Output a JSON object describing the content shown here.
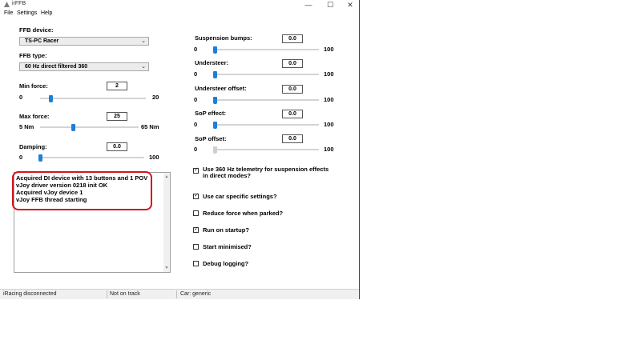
{
  "window": {
    "title": "irFFB",
    "minimize": "—",
    "maximize": "☐",
    "close": "✕"
  },
  "menu": [
    "File",
    "Settings",
    "Help"
  ],
  "left": {
    "ffb_device_label": "FFB device:",
    "ffb_device_value": "TS-PC Racer",
    "ffb_type_label": "FFB type:",
    "ffb_type_value": "60 Hz direct filtered 360",
    "min_force": {
      "label": "Min force:",
      "value": "2",
      "min": "0",
      "max": "20",
      "level": 0.1
    },
    "max_force": {
      "label": "Max force:",
      "value": "25",
      "min": "5 Nm",
      "max": "65 Nm",
      "level": 0.33
    },
    "damping": {
      "label": "Damping:",
      "value": "0.0",
      "min": "0",
      "max": "100",
      "level": 0.0
    }
  },
  "log": [
    "Acquired DI device with 13 buttons and 1 POV",
    "vJoy driver version 0218 init OK",
    "Acquired vJoy device 1",
    "vJoy FFB thread starting"
  ],
  "right": {
    "suspension_bumps": {
      "label": "Suspension bumps:",
      "value": "0.0",
      "min": "0",
      "max": "100",
      "level": 0.0
    },
    "understeer": {
      "label": "Understeer:",
      "value": "0.0",
      "min": "0",
      "max": "100",
      "level": 0.0
    },
    "understeer_offset": {
      "label": "Understeer offset:",
      "value": "0.0",
      "min": "0",
      "max": "100",
      "level": 0.0
    },
    "sop_effect": {
      "label": "SoP effect:",
      "value": "0.0",
      "min": "0",
      "max": "100",
      "level": 0.0
    },
    "sop_offset": {
      "label": "SoP offset:",
      "value": "0.0",
      "min": "0",
      "max": "100",
      "level": 0.0
    }
  },
  "checkboxes": {
    "use360": {
      "label_line1": "Use 360 Hz telemetry for suspension effects",
      "label_line2": "in direct modes?",
      "checked": true
    },
    "car_specific": {
      "label": "Use car specific settings?",
      "checked": true
    },
    "reduce_parked": {
      "label": "Reduce force when parked?",
      "checked": false
    },
    "run_startup": {
      "label": "Run on startup?",
      "checked": true
    },
    "start_minimised": {
      "label": "Start minimised?",
      "checked": false
    },
    "debug_logging": {
      "label": "Debug logging?",
      "checked": false
    }
  },
  "status": {
    "iracing": "iRacing disconnected",
    "track": "Not on track",
    "car": "Car: generic"
  },
  "colors": {
    "accent": "#1c7fd8",
    "highlight": "#d4141f"
  }
}
